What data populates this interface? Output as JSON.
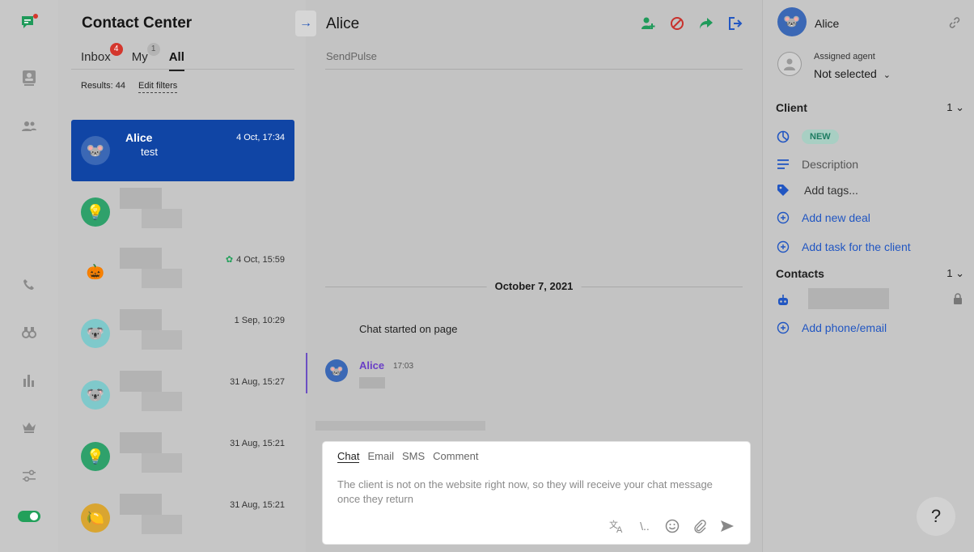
{
  "colors": {
    "accent": "#1045a5",
    "link": "#2156c2",
    "badge_red": "#d4372d",
    "green": "#22a05a"
  },
  "rail": {
    "icons": [
      "chat-icon",
      "contacts-card-icon",
      "users-icon",
      "phone-icon",
      "binoculars-icon",
      "bar-chart-icon",
      "crown-icon",
      "sliders-icon",
      "toggle-icon"
    ]
  },
  "list": {
    "title": "Contact Center",
    "tabs": [
      {
        "label": "Inbox",
        "badge": "4"
      },
      {
        "label": "My",
        "badge": "1"
      },
      {
        "label": "All",
        "badge": ""
      }
    ],
    "results": "Results: 44",
    "edit_filters": "Edit filters",
    "conversations": [
      {
        "name": "Alice",
        "message": "test",
        "time": "4 Oct, 17:34",
        "avatar": "mouse-avatar"
      },
      {
        "name": "",
        "message": "",
        "time": "",
        "avatar": "bulb-avatar"
      },
      {
        "name": "",
        "message": "",
        "time": "4 Oct, 15:59",
        "avatar": "pumpkin-avatar"
      },
      {
        "name": "",
        "message": "",
        "time": "1 Sep, 10:29",
        "avatar": "koala-avatar"
      },
      {
        "name": "",
        "message": "",
        "time": "31 Aug, 15:27",
        "avatar": "koala-avatar"
      },
      {
        "name": "",
        "message": "",
        "time": "31 Aug, 15:21",
        "avatar": "bulb-avatar"
      },
      {
        "name": "",
        "message": "",
        "time": "31 Aug, 15:21",
        "avatar": "lemon-avatar"
      }
    ]
  },
  "chat": {
    "title": "Alice",
    "subtitle": "SendPulse",
    "date_separator": "October 7, 2021",
    "system_message": "Chat started on page",
    "message": {
      "author": "Alice",
      "time": "17:03"
    },
    "composer": {
      "tabs": [
        "Chat",
        "Email",
        "SMS",
        "Comment"
      ],
      "hint": "The client is not on the website right now, so they will receive your chat message once they return",
      "tools": [
        "\\.."
      ]
    }
  },
  "right": {
    "name": "Alice",
    "assigned_label": "Assigned agent",
    "assigned_value": "Not selected",
    "client_section": "Client",
    "client_count": "1",
    "status_badge": "NEW",
    "description": "Description",
    "add_tags": "Add tags...",
    "add_deal": "Add new deal",
    "add_task": "Add task for the client",
    "contacts_section": "Contacts",
    "contacts_count": "1",
    "add_phone": "Add phone/email"
  },
  "help_label": "?"
}
